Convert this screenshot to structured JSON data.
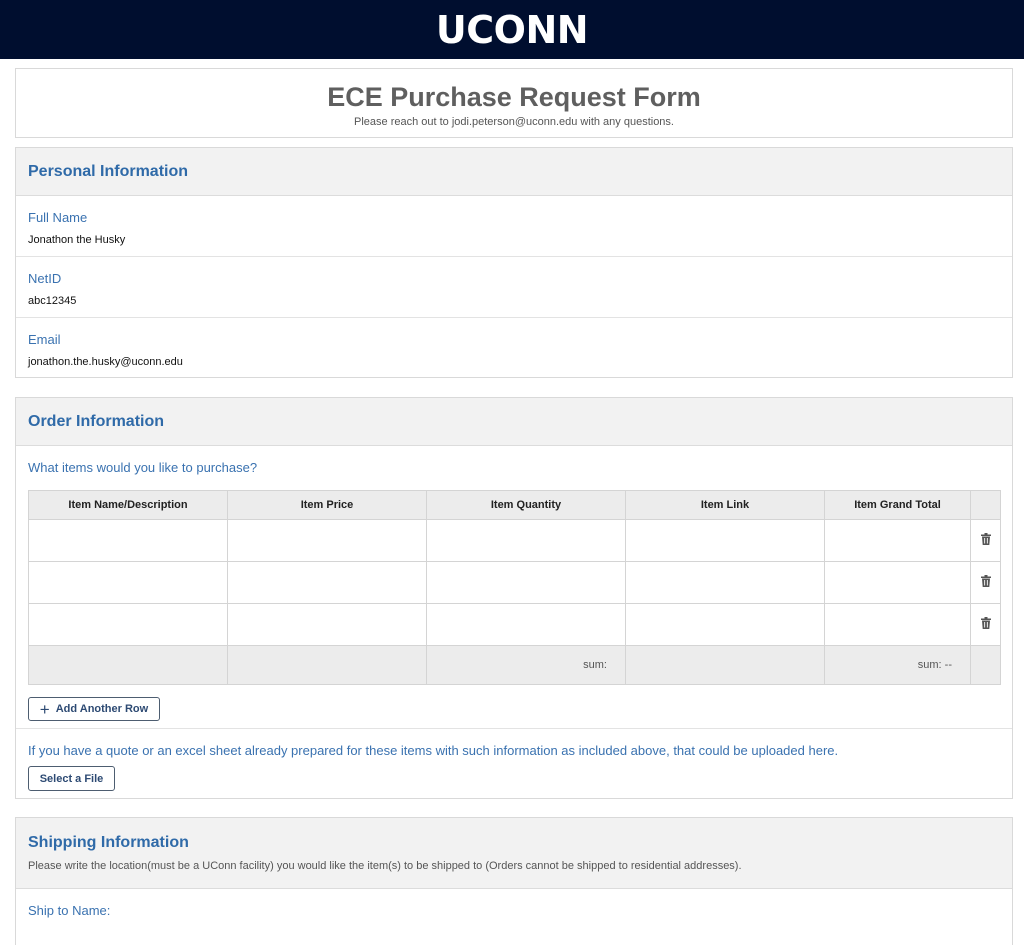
{
  "header": {
    "logo": "UCONN"
  },
  "form": {
    "title": "ECE Purchase Request Form",
    "subtitle": "Please reach out to jodi.peterson@uconn.edu with any questions."
  },
  "personal": {
    "title": "Personal Information",
    "fields": [
      {
        "label": "Full Name",
        "value": "Jonathon the Husky"
      },
      {
        "label": "NetID",
        "value": "abc12345"
      },
      {
        "label": "Email",
        "value": "jonathon.the.husky@uconn.edu"
      }
    ]
  },
  "order": {
    "title": "Order Information",
    "question": "What items would you like to purchase?",
    "columns": [
      "Item Name/Description",
      "Item Price",
      "Item Quantity",
      "Item Link",
      "Item Grand Total"
    ],
    "row_count": 3,
    "sum_quantity_label": "sum:",
    "sum_total_label": "sum:  --",
    "add_row_label": "Add Another Row",
    "upload_text": "If you have a quote or an excel sheet already prepared for these items with such information as included above, that could be uploaded here.",
    "select_file_label": "Select a File"
  },
  "shipping": {
    "title": "Shipping Information",
    "description": "Please write the location(must be a UConn facility) you would like the item(s) to be shipped to (Orders cannot be shipped to residential addresses).",
    "ship_to_label": "Ship to Name:"
  },
  "icons": {
    "delete": "trash-icon",
    "add": "plus-icon"
  },
  "colors": {
    "header_bg": "#000e2f",
    "accent": "#3a72b0",
    "section_bg": "#f2f2f2"
  }
}
